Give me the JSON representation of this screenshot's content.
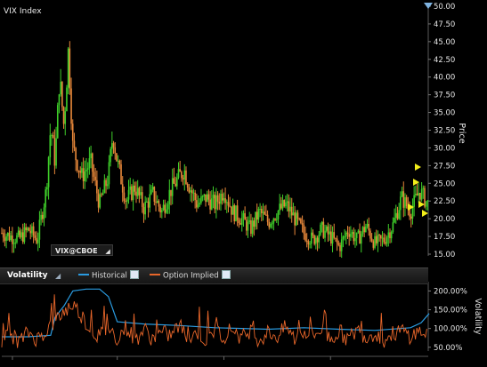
{
  "main_title": "VIX Index",
  "symbol_badge": "VIX@CBOE",
  "volatility_label": "Volatility",
  "legend": {
    "historical": "Historical",
    "option_implied": "Option Implied"
  },
  "colors": {
    "background": "#000000",
    "candle_up": "#3fcf2a",
    "candle_down": "#e8883a",
    "historical_line": "#2a9be0",
    "implied_line": "#e8662a",
    "marker": "#f2ee1a"
  },
  "chart_data": [
    {
      "type": "candlestick",
      "title": "VIX Index",
      "ylabel": "Price",
      "ylim": [
        14.0,
        50.0
      ],
      "yticks": [
        "15.00",
        "17.50",
        "20.00",
        "22.50",
        "25.00",
        "27.50",
        "30.00",
        "32.50",
        "35.00",
        "37.50",
        "40.00",
        "42.50",
        "45.00",
        "47.50",
        "50.00"
      ],
      "grid": false,
      "x": [
        0,
        10,
        20,
        30,
        40,
        50,
        55,
        60,
        65,
        70,
        75,
        80,
        90,
        100,
        110,
        120,
        125,
        130,
        140,
        150,
        160,
        170,
        180,
        190,
        200,
        205,
        210,
        220,
        230,
        240,
        250,
        260,
        270,
        280,
        290,
        300,
        310,
        320,
        330,
        340,
        350,
        360,
        370,
        380,
        390,
        400,
        410,
        420,
        430,
        440,
        450,
        460,
        470,
        480
      ],
      "values": [
        18.0,
        17.5,
        17.2,
        18.5,
        17.0,
        24.0,
        33.0,
        28.0,
        40.0,
        33.0,
        44.0,
        30.0,
        26.0,
        28.0,
        22.0,
        26.0,
        32.0,
        28.0,
        22.5,
        24.5,
        21.5,
        23.5,
        21.0,
        24.0,
        26.0,
        27.0,
        25.0,
        22.0,
        23.0,
        22.0,
        24.0,
        21.0,
        20.0,
        18.5,
        21.0,
        19.5,
        21.0,
        22.0,
        20.0,
        18.0,
        17.0,
        18.5,
        17.5,
        16.0,
        18.5,
        17.0,
        19.0,
        16.5,
        17.0,
        19.0,
        23.0,
        21.0,
        24.0,
        22.0
      ]
    },
    {
      "type": "line",
      "ylabel": "Volatility",
      "yticks": [
        "50.00%",
        "100.00%",
        "150.00%",
        "200.00%"
      ],
      "ylim": [
        40,
        220
      ],
      "series": [
        {
          "name": "Historical",
          "x": [
            0,
            30,
            55,
            60,
            70,
            80,
            95,
            110,
            120,
            130,
            160,
            200,
            240,
            300,
            340,
            380,
            420,
            460,
            472,
            481
          ],
          "values": [
            78,
            78,
            82,
            130,
            160,
            200,
            205,
            205,
            185,
            118,
            112,
            108,
            102,
            98,
            102,
            98,
            95,
            102,
            115,
            140
          ]
        },
        {
          "name": "Option Implied",
          "x": [
            0,
            10,
            20,
            30,
            40,
            50,
            60,
            70,
            80,
            90,
            100,
            110,
            120,
            130,
            140,
            150,
            160,
            170,
            180,
            190,
            200,
            210,
            220,
            230,
            240,
            250,
            260,
            270,
            280,
            290,
            300,
            310,
            320,
            330,
            340,
            350,
            360,
            370,
            380,
            390,
            400,
            410,
            420,
            430,
            440,
            450,
            460,
            470,
            480
          ],
          "values": [
            70,
            85,
            65,
            90,
            72,
            95,
            120,
            145,
            165,
            135,
            95,
            80,
            100,
            75,
            105,
            68,
            98,
            72,
            88,
            82,
            110,
            70,
            92,
            66,
            95,
            80,
            102,
            74,
            96,
            69,
            91,
            78,
            104,
            71,
            94,
            80,
            99,
            73,
            92,
            70,
            97,
            76,
            90,
            68,
            85,
            95,
            80,
            92,
            86
          ]
        }
      ]
    }
  ]
}
